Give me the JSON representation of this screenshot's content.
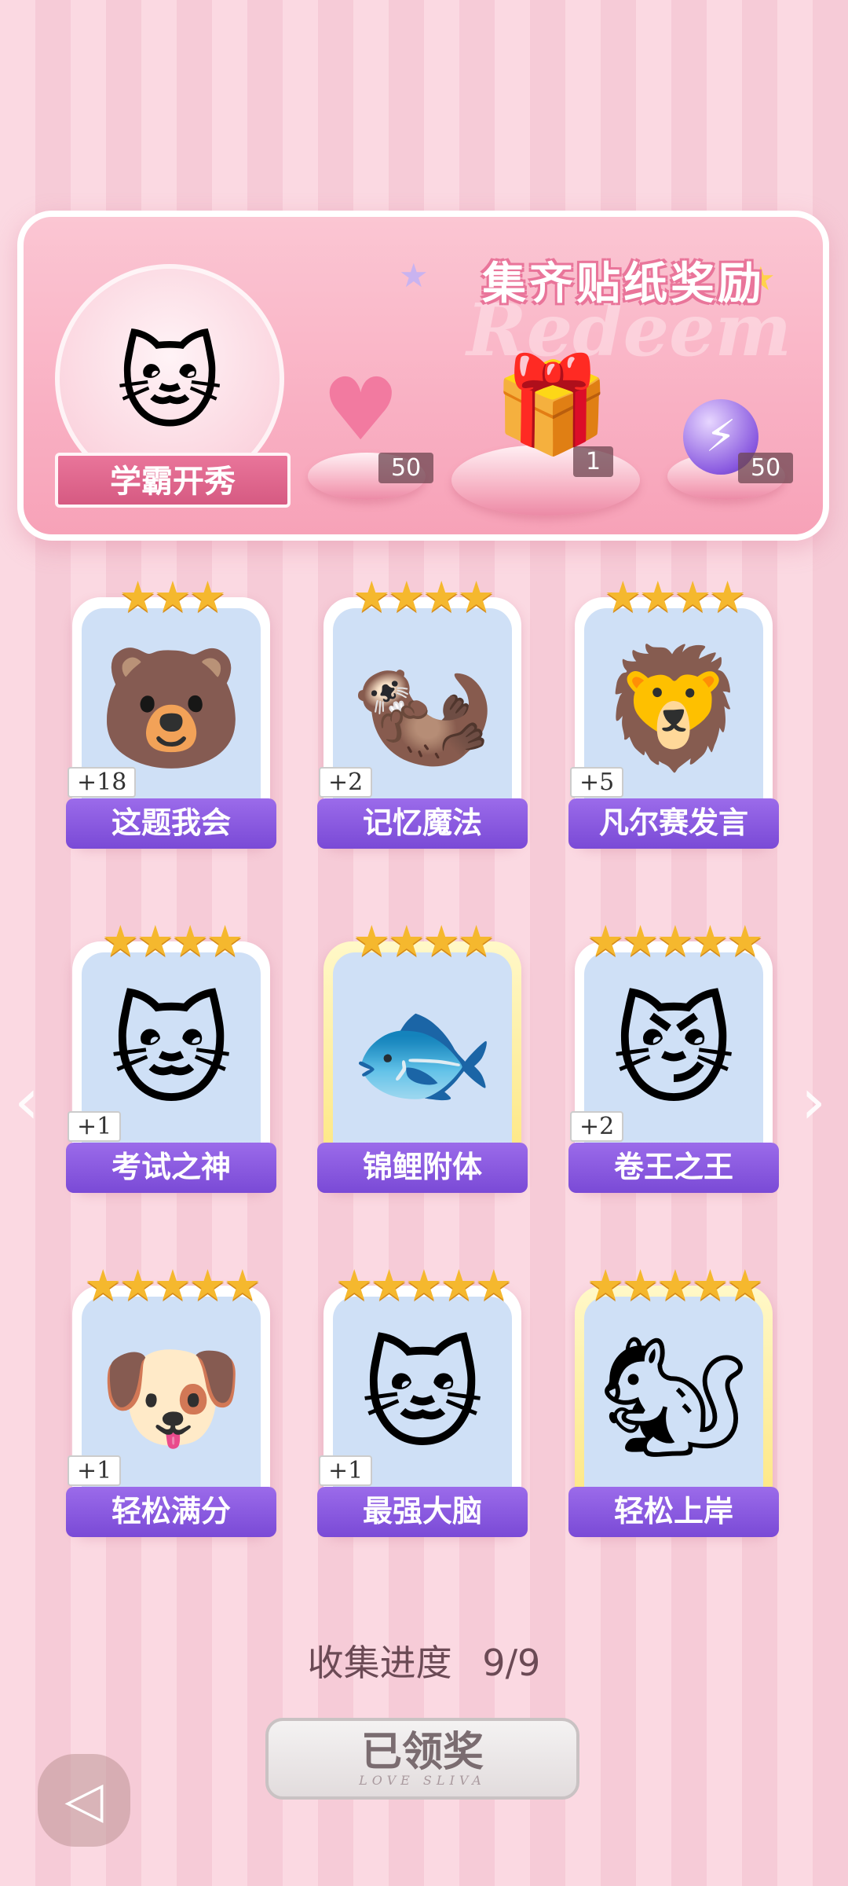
{
  "banner": {
    "title": "集齐贴纸奖励",
    "bg_word": "Redeem",
    "sticker_label": "学霸开秀",
    "rewards": [
      {
        "icon": "pink-heart-gem-icon",
        "count": "50"
      },
      {
        "icon": "gift-box-icon",
        "count": "1"
      },
      {
        "icon": "purple-energy-orb-icon",
        "count": "50"
      }
    ]
  },
  "cards": [
    {
      "name": "这题我会",
      "plus": "+18",
      "stars": "★★★",
      "icon": "bear-at-desk-icon"
    },
    {
      "name": "记忆魔法",
      "plus": "+2",
      "stars": "★★★★",
      "icon": "wizard-otter-icon"
    },
    {
      "name": "凡尔赛发言",
      "plus": "+5",
      "stars": "★★★★",
      "icon": "lion-microphone-icon"
    },
    {
      "name": "考试之神",
      "plus": "+1",
      "stars": "★★★★",
      "icon": "angel-cat-icon"
    },
    {
      "name": "锦鲤附体",
      "plus": "",
      "stars": "★★★★",
      "icon": "bear-koi-fish-icon"
    },
    {
      "name": "卷王之王",
      "plus": "+2",
      "stars": "★★★★★",
      "icon": "studying-cat-icon"
    },
    {
      "name": "轻松满分",
      "plus": "+1",
      "stars": "★★★★★",
      "icon": "puppy-full-score-icon"
    },
    {
      "name": "最强大脑",
      "plus": "+1",
      "stars": "★★★★★",
      "icon": "cat-documents-icon"
    },
    {
      "name": "轻松上岸",
      "plus": "",
      "stars": "★★★★★",
      "icon": "graduate-squirrel-icon"
    }
  ],
  "progress": {
    "label": "收集进度",
    "value": "9/9"
  },
  "claim_button": {
    "label": "已领奖",
    "sub": "LOVE SLIVA"
  },
  "nav": {
    "prev": "‹",
    "next": "›"
  },
  "colors": {
    "accent_pink": "#e9759a",
    "card_name_purple": "#8a5ae0",
    "star_gold": "#f5b82e"
  }
}
